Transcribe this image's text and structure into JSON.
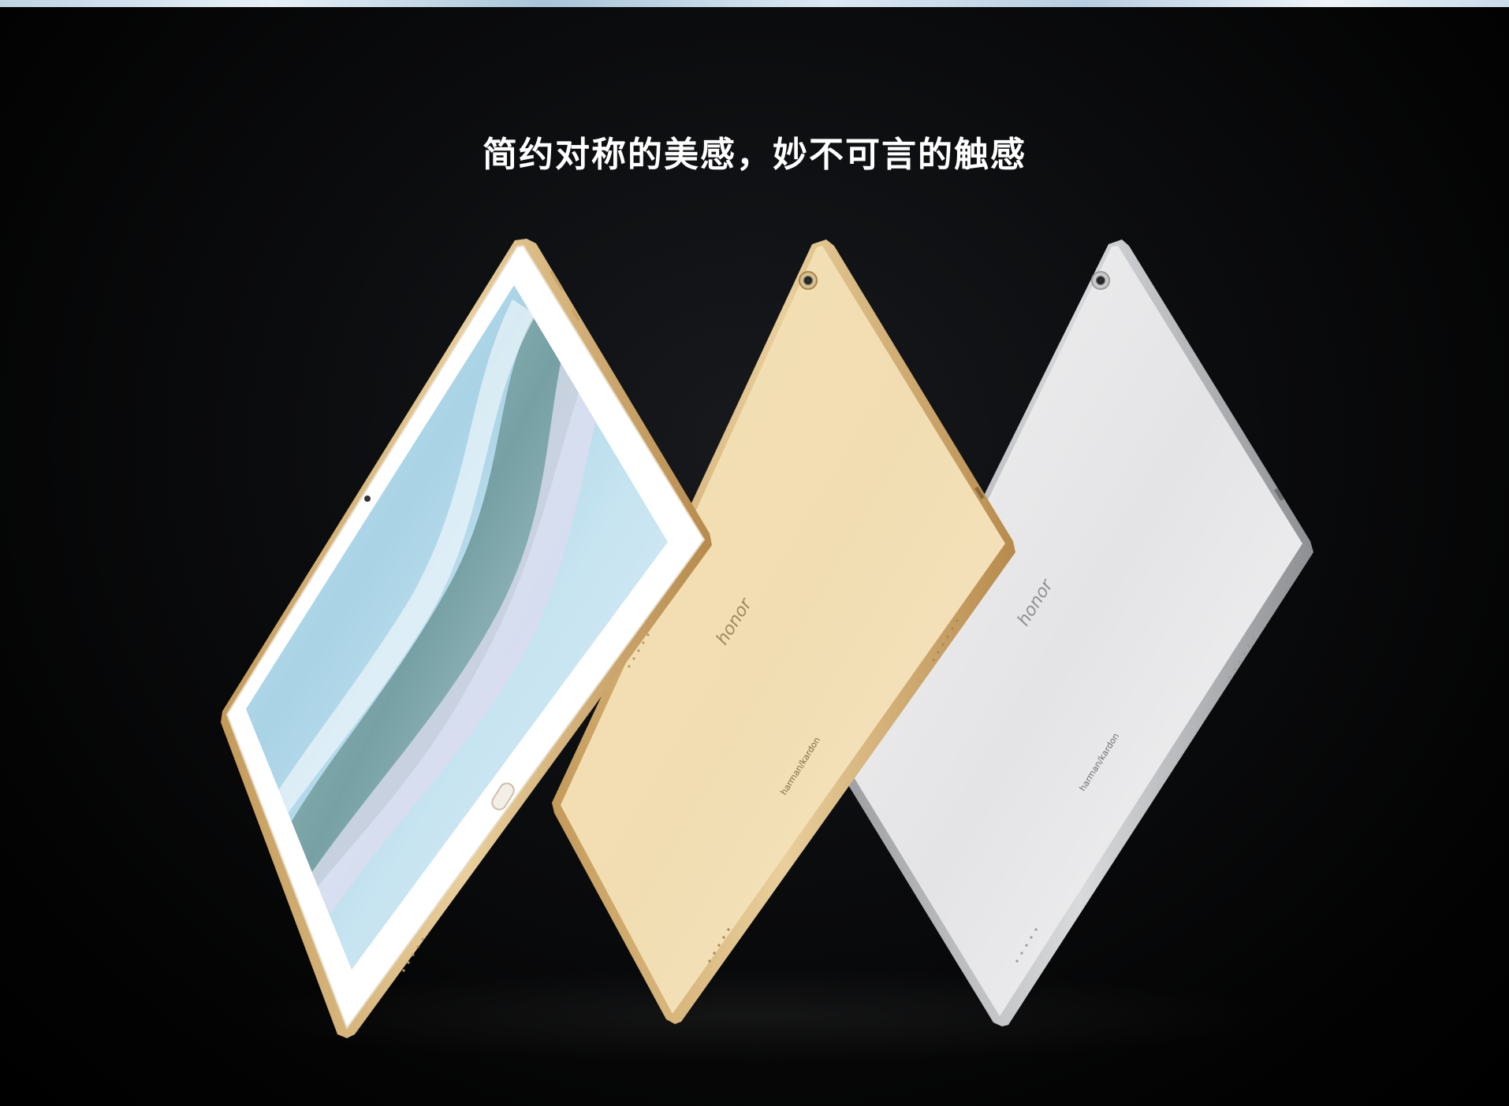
{
  "headline": "简约对称的美感，妙不可言的触感",
  "tablets": {
    "gold_back": {
      "brand": "honor",
      "audio_brand": "harman/kardon"
    },
    "silver_back": {
      "brand": "honor",
      "audio_brand": "harman/kardon"
    }
  },
  "colors": {
    "background": "#000000",
    "gold_finish": "#f3dfb5",
    "silver_finish": "#e9e9ea",
    "front_bezel": "#ffffff"
  }
}
